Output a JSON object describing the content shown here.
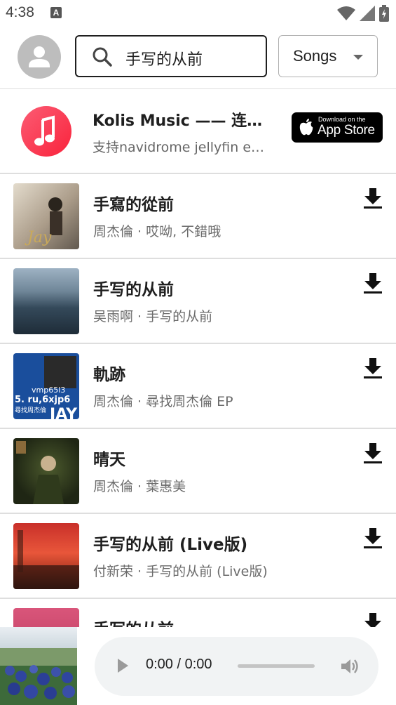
{
  "status_bar": {
    "time": "4:38",
    "notif_letter": "A"
  },
  "search": {
    "query": "手写的从前"
  },
  "filter": {
    "selected": "Songs"
  },
  "promo": {
    "title": "Kolis Music —— 连接Navidrome",
    "subtitle": "支持navidrome jellyfin emby plex",
    "store_small": "Download on the",
    "store_big": "App Store"
  },
  "songs": [
    {
      "title": "手寫的從前",
      "subtitle": "周杰倫 · 哎呦, 不錯哦",
      "cover_text": "Jay"
    },
    {
      "title": "手写的从前",
      "subtitle": "吴雨啊 · 手写的从前"
    },
    {
      "title": "軌跡",
      "subtitle": "周杰倫 · 尋找周杰倫 EP",
      "cover_text": "JAY",
      "cover_text2": "vmp65l3",
      "cover_text3": "5. ru,6xjp6",
      "cover_text4": "尋找周杰倫"
    },
    {
      "title": "晴天",
      "subtitle": "周杰倫 · 葉惠美"
    },
    {
      "title": "手写的从前 (Live版)",
      "subtitle": "付新荣 · 手写的从前 (Live版)"
    },
    {
      "title": "手写的从前",
      "subtitle": ""
    }
  ],
  "player": {
    "time": "0:00 / 0:00",
    "progress": 0
  },
  "icons": [
    "person-icon",
    "search-icon",
    "caret-down-icon",
    "music-note-icon",
    "apple-icon",
    "download-icon",
    "play-icon",
    "volume-icon",
    "wifi-icon",
    "signal-icon",
    "battery-icon"
  ]
}
